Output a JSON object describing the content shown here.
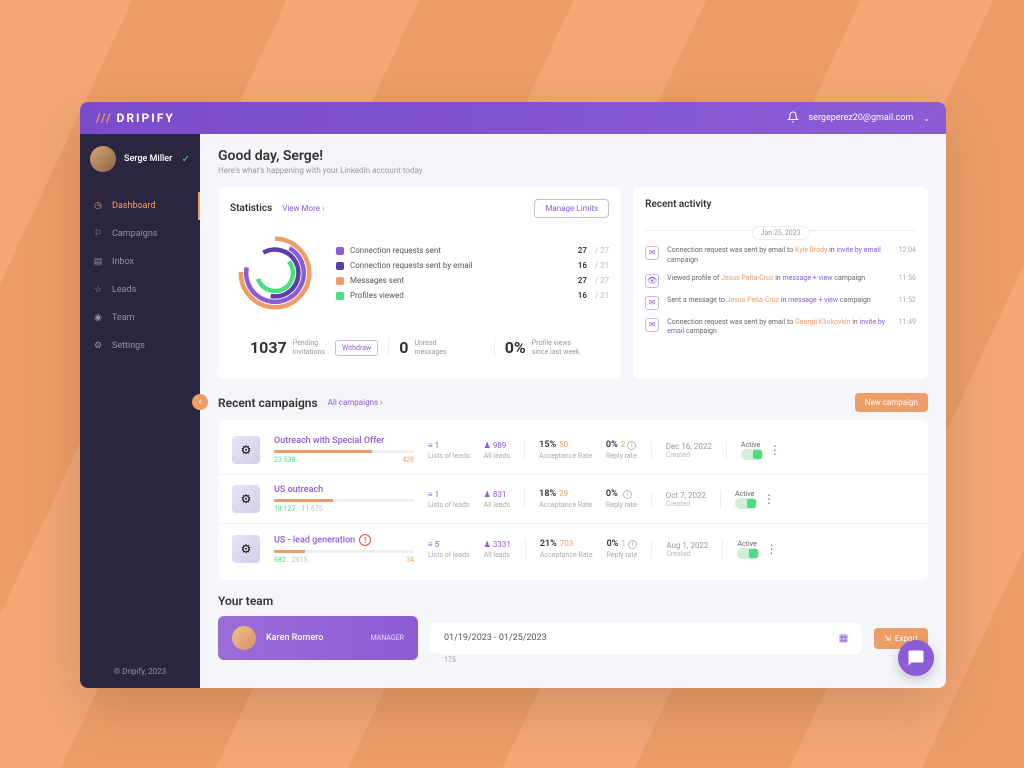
{
  "topbar": {
    "brand": "DRIPIFY",
    "email": "sergeperez20@gmail.com"
  },
  "user": {
    "name": "Serge Miller"
  },
  "nav": {
    "items": [
      {
        "label": "Dashboard"
      },
      {
        "label": "Campaigns"
      },
      {
        "label": "Inbox"
      },
      {
        "label": "Leads"
      },
      {
        "label": "Team"
      },
      {
        "label": "Settings"
      }
    ]
  },
  "footer": "© Dripify, 2023",
  "greeting": {
    "title": "Good day, Serge!",
    "sub": "Here's what's happening with your LinkedIn account today"
  },
  "stats": {
    "title": "Statistics",
    "view_more": "View More",
    "manage": "Manage Limits",
    "rows": [
      {
        "label": "Connection requests sent",
        "val": "27",
        "max": "27",
        "color": "#8b5cd6"
      },
      {
        "label": "Connection requests sent by email",
        "val": "16",
        "max": "21",
        "color": "#5b3fa8"
      },
      {
        "label": "Messages sent",
        "val": "27",
        "max": "27",
        "color": "#ed9e68"
      },
      {
        "label": "Profiles viewed",
        "val": "16",
        "max": "21",
        "color": "#4ade80"
      }
    ]
  },
  "quick": [
    {
      "num": "1037",
      "l1": "Pending",
      "l2": "invitations",
      "btn": "Withdraw"
    },
    {
      "num": "0",
      "l1": "Unread",
      "l2": "messages"
    },
    {
      "num": "0%",
      "l1": "Profile views",
      "l2": "since last week"
    }
  ],
  "activity": {
    "title": "Recent activity",
    "date": "Jan 25, 2023",
    "items": [
      {
        "icon": "✉",
        "pre": "Connection request was sent by email to ",
        "hl": "Kyle Brady",
        "mid": " in ",
        "hl2": "invite by email",
        "suf": " campaign",
        "time": "12:04"
      },
      {
        "icon": "👁",
        "pre": "Viewed profile of ",
        "hl": "Jesus Peña-Cruz",
        "mid": " in ",
        "hl2": "message + view",
        "suf": " campaign",
        "time": "11:56"
      },
      {
        "icon": "✉",
        "pre": "Sent a message to ",
        "hl": "Jesus Peña-Cruz",
        "mid": " in ",
        "hl2": "message + view",
        "suf": " campaign",
        "time": "11:52"
      },
      {
        "icon": "✉",
        "pre": "Connection request was sent by email to ",
        "hl": "Georgii Kliukovkin",
        "mid": " in ",
        "hl2": "invite by email",
        "suf": " campaign",
        "time": "11:49"
      }
    ]
  },
  "campaigns": {
    "title": "Recent campaigns",
    "all": "All campaigns",
    "new": "New campaign",
    "rows": [
      {
        "name": "Outreach with Special Offer",
        "g": "23 538",
        "grey": "",
        "o": "428",
        "bar": 70,
        "lists": "1",
        "leads": "989",
        "acc": "15%",
        "accn": "50",
        "rep": "0%",
        "repn": "2",
        "date": "Dec 16, 2022",
        "status": "Active",
        "alert": false
      },
      {
        "name": "US outreach",
        "g": "18 127",
        "grey": "11 675",
        "o": "",
        "bar": 42,
        "lists": "1",
        "leads": "831",
        "acc": "18%",
        "accn": "29",
        "rep": "0%",
        "repn": "",
        "date": "Oct 7, 2022",
        "status": "Active",
        "alert": false
      },
      {
        "name": "US - lead generation",
        "g": "682",
        "grey": "2615",
        "o": "34",
        "bar": 22,
        "lists": "5",
        "leads": "3331",
        "acc": "21%",
        "accn": "703",
        "rep": "0%",
        "repn": "1",
        "date": "Aug 1, 2022",
        "status": "Active",
        "alert": true
      }
    ],
    "labels": {
      "lists": "Lists of leads",
      "leads": "All leads",
      "acc": "Acceptance Rate",
      "rep": "Reply rate",
      "created": "Created"
    }
  },
  "team": {
    "title": "Your team",
    "member": {
      "name": "Karen Romero",
      "role": "MANAGER"
    },
    "range": "01/19/2023  -  01/25/2023",
    "count": "175",
    "export": "Export"
  },
  "chart_data": {
    "type": "pie",
    "title": "Statistics",
    "series": [
      {
        "name": "Connection requests sent",
        "value": 27,
        "max": 27,
        "color": "#8b5cd6"
      },
      {
        "name": "Connection requests sent by email",
        "value": 16,
        "max": 21,
        "color": "#5b3fa8"
      },
      {
        "name": "Messages sent",
        "value": 27,
        "max": 27,
        "color": "#ed9e68"
      },
      {
        "name": "Profiles viewed",
        "value": 16,
        "max": 21,
        "color": "#4ade80"
      }
    ]
  }
}
